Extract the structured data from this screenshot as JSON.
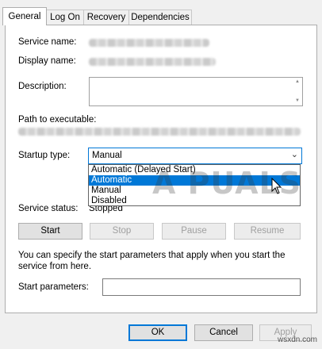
{
  "tabs": [
    {
      "label": "General"
    },
    {
      "label": "Log On"
    },
    {
      "label": "Recovery"
    },
    {
      "label": "Dependencies"
    }
  ],
  "fields": {
    "service_name_label": "Service name:",
    "display_name_label": "Display name:",
    "description_label": "Description:",
    "path_label": "Path to executable:",
    "startup_type_label": "Startup type:",
    "service_status_label": "Service status:",
    "service_status_value": "Stopped"
  },
  "startup_type": {
    "selected": "Manual",
    "options": [
      "Automatic (Delayed Start)",
      "Automatic",
      "Manual",
      "Disabled"
    ],
    "highlighted_index": 1
  },
  "service_buttons": {
    "start": "Start",
    "stop": "Stop",
    "pause": "Pause",
    "resume": "Resume"
  },
  "help_text": "You can specify the start parameters that apply when you start the service from here.",
  "start_parameters_label": "Start parameters:",
  "dialog_buttons": {
    "ok": "OK",
    "cancel": "Cancel",
    "apply": "Apply"
  },
  "watermark": {
    "logo_text": "A PUALS",
    "site": "wsxdn.com"
  },
  "colors": {
    "accent": "#0078d7",
    "window_bg": "#f0f0f0",
    "disabled_text": "#a0a0a0"
  }
}
